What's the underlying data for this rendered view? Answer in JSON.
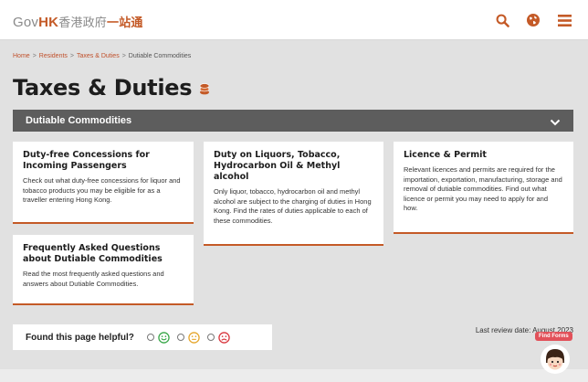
{
  "header": {
    "logo_gov": "Gov",
    "logo_hk": "HK",
    "logo_zh": "香港政府",
    "logo_zh2": "一站通",
    "icons": [
      "search-icon",
      "globe-icon",
      "menu-icon"
    ],
    "accent": "#c45a27"
  },
  "breadcrumb": {
    "items": [
      "Home",
      "Residents",
      "Taxes & Duties",
      "Dutiable Commodities"
    ],
    "separator": ">"
  },
  "page": {
    "title": "Taxes & Duties",
    "title_icon": "coins-icon"
  },
  "accordion": {
    "label": "Dutiable Commodities",
    "icon": "chevron-down-icon"
  },
  "cards": [
    {
      "title": "Duty-free Concessions for Incoming Passengers",
      "body": "Check out what duty-free concessions for liquor and tobacco products you may be eligible for as a traveller entering Hong Kong."
    },
    {
      "title": "Duty on Liquors, Tobacco, Hydrocarbon Oil & Methyl alcohol",
      "body": "Only liquor, tobacco, hydrocarbon oil and methyl alcohol are subject to the charging of duties in Hong Kong. Find the rates of duties applicable to each of these commodities."
    },
    {
      "title": "Licence & Permit",
      "body": "Relevant licences and permits are required for the importation, exportation, manufacturing, storage and removal of dutiable commodities. Find out what licence or permit you may need to apply for and how."
    },
    {
      "title": "Frequently Asked Questions about Dutiable Commodities",
      "body": "Read the most frequently asked questions and answers about Dutiable Commodities."
    }
  ],
  "feedback": {
    "question": "Found this page helpful?",
    "options": [
      "happy-face-icon",
      "neutral-face-icon",
      "sad-face-icon"
    ]
  },
  "review": {
    "text": "Last review date: August 2023"
  },
  "find_forms": {
    "label": "Find Forms",
    "icon": "mascot-icon"
  }
}
